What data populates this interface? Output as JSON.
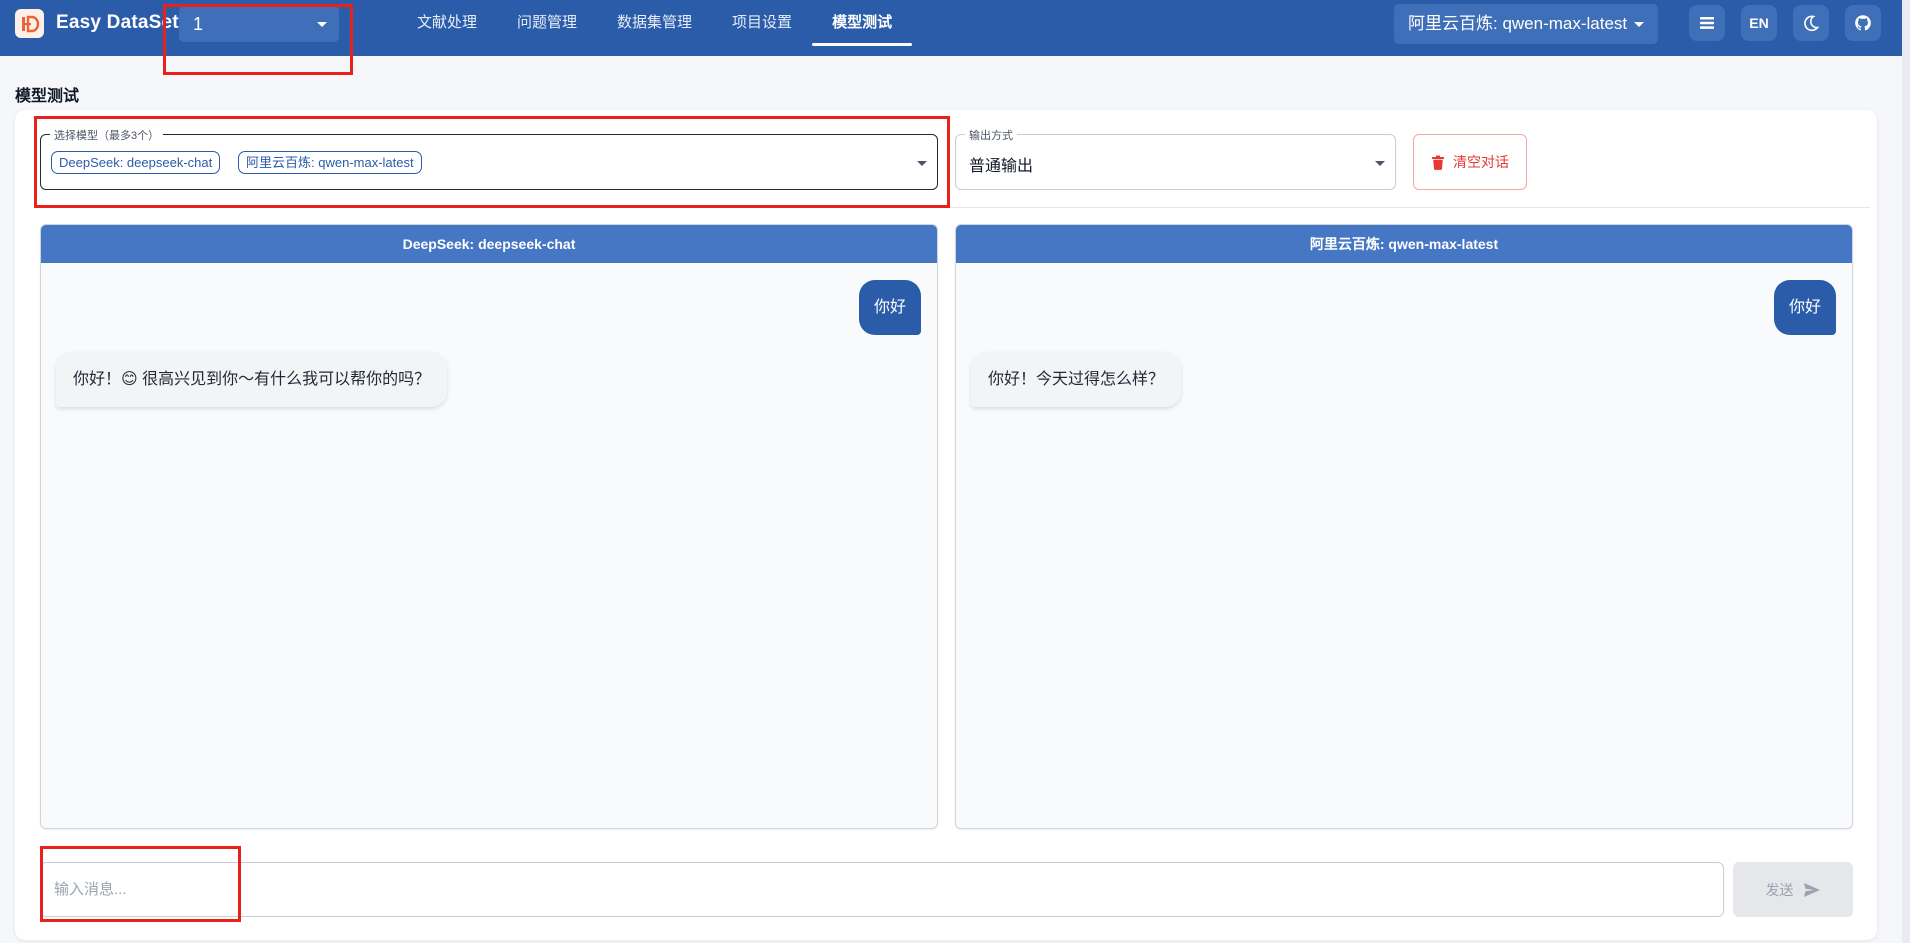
{
  "header": {
    "app_title": "Easy DataSet",
    "project_value": "1",
    "nav": [
      {
        "label": "文献处理",
        "active": false
      },
      {
        "label": "问题管理",
        "active": false
      },
      {
        "label": "数据集管理",
        "active": false
      },
      {
        "label": "项目设置",
        "active": false
      },
      {
        "label": "模型测试",
        "active": true
      }
    ],
    "model_selected": "阿里云百炼: qwen-max-latest",
    "lang_label": "EN",
    "icons": [
      "list-icon",
      "language-icon",
      "moon-icon",
      "github-icon"
    ]
  },
  "page": {
    "title": "模型测试"
  },
  "controls": {
    "models_legend": "选择模型（最多3个）",
    "model_chips": [
      "DeepSeek: deepseek-chat",
      "阿里云百炼: qwen-max-latest"
    ],
    "output_legend": "输出方式",
    "output_value": "普通输出",
    "clear_label": "清空对话"
  },
  "panels": [
    {
      "title": "DeepSeek: deepseek-chat",
      "user_message": "你好",
      "bot_message": "你好！😊 很高兴见到你～有什么我可以帮你的吗？"
    },
    {
      "title": "阿里云百炼: qwen-max-latest",
      "user_message": "你好",
      "bot_message": "你好！今天过得怎么样？"
    }
  ],
  "composer": {
    "placeholder": "输入消息...",
    "send_label": "发送"
  },
  "colors": {
    "brand": "#2a5caa",
    "panel_header": "#4677c4",
    "danger": "#e53935",
    "annotation": "#e8211a"
  }
}
